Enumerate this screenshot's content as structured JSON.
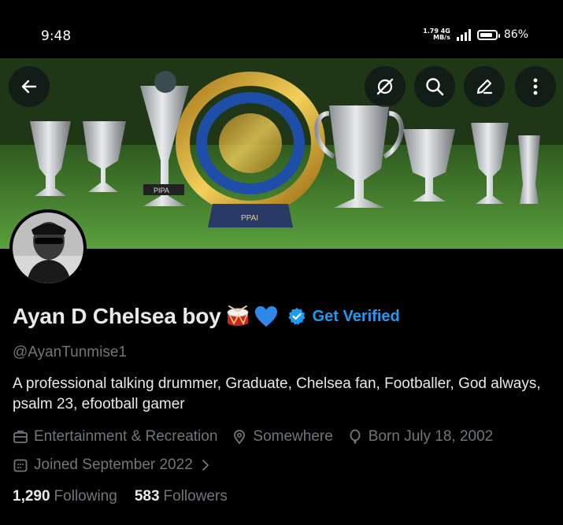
{
  "status_bar": {
    "time": "9:48",
    "net_speed_value": "1.79",
    "net_speed_unit": "MB/s",
    "net_type": "4G",
    "battery_level_fraction": 0.86,
    "battery_text": "86%"
  },
  "header": {
    "back_icon": "arrow-left-icon",
    "actions": [
      "grok-icon",
      "search-icon",
      "edit-icon",
      "more-vertical-icon"
    ]
  },
  "banner": {
    "trophy_plaque_text": "PIPA",
    "center_trophy_text": "PPAI",
    "description": "football trophies on grass"
  },
  "profile": {
    "name": "Ayan D Chelsea boy",
    "name_emojis": [
      "drum",
      "blue-heart"
    ],
    "get_verified": "Get Verified",
    "handle": "@AyanTunmise1",
    "bio": "A professional talking drummer, Graduate, Chelsea fan, Footballer, God always, psalm 23, efootball gamer",
    "category": "Entertainment & Recreation",
    "location": "Somewhere",
    "born": "Born July 18, 2002",
    "joined": "Joined September 2022",
    "following_count": "1,290",
    "following_label": "Following",
    "followers_count": "583",
    "followers_label": "Followers"
  },
  "colors": {
    "background": "#000000",
    "accent": "#1d9bf0",
    "secondary_text": "#71767b",
    "primary_text": "#e7e9ea"
  }
}
